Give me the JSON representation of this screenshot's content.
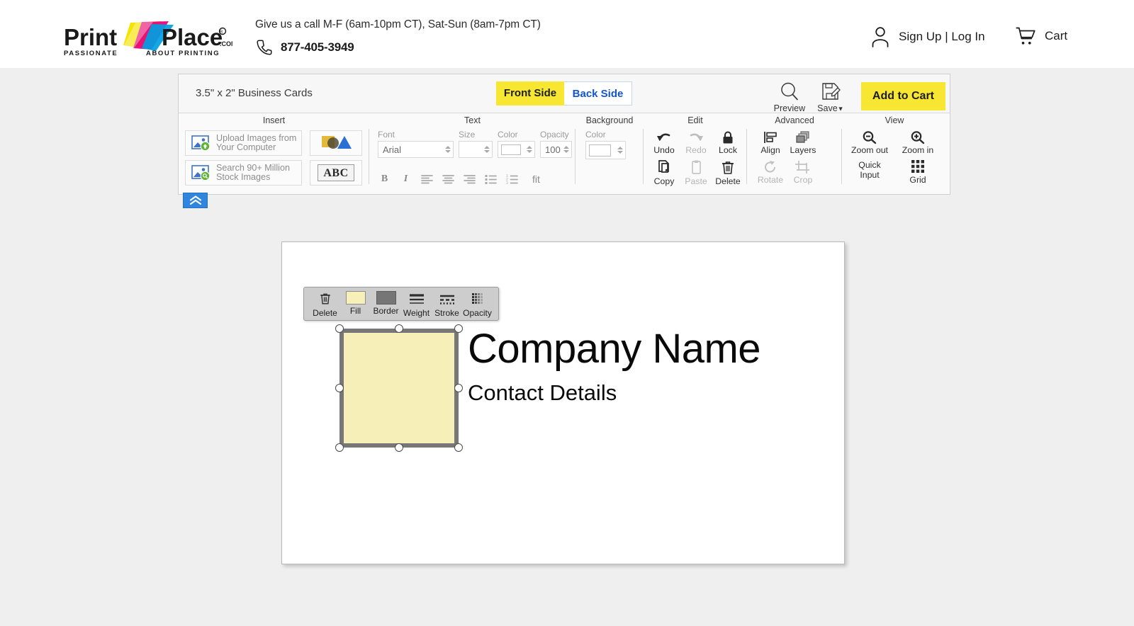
{
  "header": {
    "logo_main": "Print",
    "logo_second": "Place",
    "logo_reg": "®",
    "logo_com": ".COM",
    "logo_tagline_left": "PASSIONATE",
    "logo_tagline_right": "ABOUT PRINTING®",
    "call_text": "Give us a call M-F (6am-10pm CT), Sat-Sun (8am-7pm CT)",
    "phone": "877-405-3949",
    "account_label": "Sign Up | Log In",
    "cart_label": "Cart",
    "icons": {
      "phone": "phone-icon",
      "person": "person-icon",
      "cart": "cart-icon"
    }
  },
  "editor": {
    "product_title": "3.5\" x 2\" Business Cards",
    "tabs": [
      {
        "label": "Front Side",
        "active": true
      },
      {
        "label": "Back Side",
        "active": false
      }
    ],
    "actions": [
      {
        "label": "Preview",
        "icon": "magnifier-icon"
      },
      {
        "label": "Save",
        "icon": "save-disk-icon"
      }
    ],
    "add_to_cart": "Add to Cart",
    "collapse_icon": "chevron-double-up-icon"
  },
  "toolbar": {
    "groups": [
      {
        "title": "Insert",
        "buttons": [
          {
            "label": "Upload Images from\nYour Computer",
            "line1": "Upload Images from",
            "line2": "Your Computer",
            "icon": "image-upload-icon"
          },
          {
            "label": "Search 90+ Million\nStock Images",
            "line1": "Search 90+ Million",
            "line2": "Stock Images",
            "icon": "image-search-icon"
          },
          {
            "label": "Shapes",
            "icon": "shapes-icon"
          },
          {
            "label": "ABC",
            "icon": "text-abc-icon"
          }
        ]
      },
      {
        "title": "Text",
        "fields": {
          "font_label": "Font",
          "font_value": "Arial",
          "size_label": "Size",
          "size_value": "",
          "color_label": "Color",
          "color_value": "#ffffff",
          "opacity_label": "Opacity",
          "opacity_value": "100"
        },
        "format_buttons": [
          {
            "name": "bold",
            "label": "B"
          },
          {
            "name": "italic",
            "label": "I"
          },
          {
            "name": "align-left",
            "label": ""
          },
          {
            "name": "align-center",
            "label": ""
          },
          {
            "name": "align-right",
            "label": ""
          },
          {
            "name": "bullet-list",
            "label": ""
          },
          {
            "name": "numbered-list",
            "label": ""
          },
          {
            "name": "fit",
            "label": "fit"
          }
        ]
      },
      {
        "title": "Background",
        "color_label": "Color",
        "color_value": "#ffffff"
      },
      {
        "title": "Edit",
        "items": [
          {
            "label": "Undo",
            "icon": "undo-arrow-icon",
            "disabled": false
          },
          {
            "label": "Redo",
            "icon": "redo-arrow-icon",
            "disabled": true
          },
          {
            "label": "Lock",
            "icon": "padlock-icon",
            "disabled": false
          },
          {
            "label": "Copy",
            "icon": "copy-pages-icon",
            "disabled": false
          },
          {
            "label": "Paste",
            "icon": "paste-clipboard-icon",
            "disabled": true
          },
          {
            "label": "Delete",
            "icon": "trash-can-icon",
            "disabled": false
          }
        ]
      },
      {
        "title": "Advanced",
        "items": [
          {
            "label": "Align",
            "icon": "align-icon",
            "disabled": false
          },
          {
            "label": "Layers",
            "icon": "layers-icon",
            "disabled": false
          },
          {
            "label": "Rotate",
            "icon": "rotate-icon",
            "disabled": true
          },
          {
            "label": "Crop",
            "icon": "crop-icon",
            "disabled": true
          }
        ]
      },
      {
        "title": "View",
        "items": [
          {
            "label": "Zoom out",
            "icon": "zoom-out-icon",
            "disabled": false
          },
          {
            "label": "Zoom in",
            "icon": "zoom-in-icon",
            "disabled": false
          },
          {
            "label": "Quick Input",
            "line1": "Quick",
            "line2": "Input",
            "icon": "quick-input-icon",
            "disabled": false
          },
          {
            "label": "Grid",
            "icon": "grid-dots-icon",
            "disabled": false
          }
        ]
      }
    ]
  },
  "canvas": {
    "company_name": "Company Name",
    "contact_details": "Contact Details",
    "shape": {
      "fill_color": "#f7efb8",
      "border_color": "#777777"
    },
    "shape_toolbar": [
      {
        "label": "Delete",
        "icon": "trash-can-icon"
      },
      {
        "label": "Fill",
        "icon": "fill-swatch-icon"
      },
      {
        "label": "Border",
        "icon": "border-swatch-icon"
      },
      {
        "label": "Weight",
        "icon": "line-weight-icon"
      },
      {
        "label": "Stroke",
        "icon": "stroke-style-icon"
      },
      {
        "label": "Opacity",
        "icon": "opacity-grid-icon"
      }
    ]
  },
  "colors": {
    "brand_yellow": "#f7e733",
    "link_blue": "#1155cc",
    "accent_blue": "#2e86de",
    "page_gray": "#efefef"
  }
}
